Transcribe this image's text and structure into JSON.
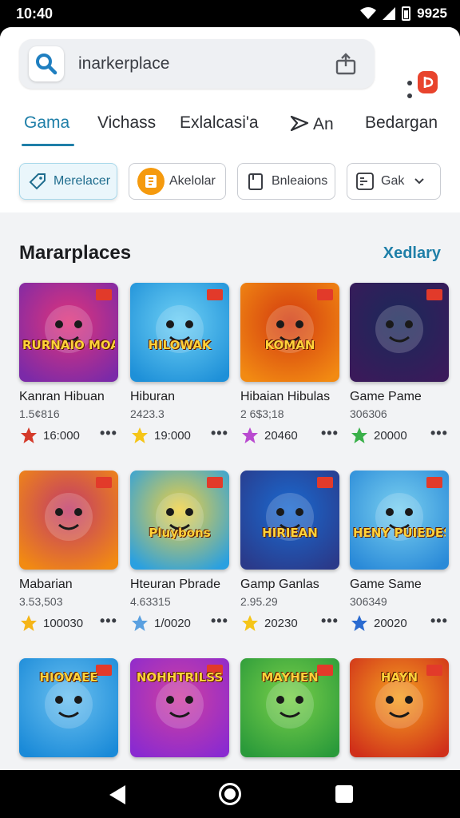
{
  "status": {
    "time": "10:40",
    "battery": "9925"
  },
  "search": {
    "query": "inarkerplace",
    "icon": "search-icon",
    "share_icon": "share-icon",
    "badge_icon": "app-badge-icon"
  },
  "tabs": [
    {
      "label": "Gama",
      "active": true
    },
    {
      "label": "Vichass",
      "active": false
    },
    {
      "label": "Exlalcasi'a",
      "active": false
    },
    {
      "label": "An",
      "active": false,
      "icon": "arrow-icon"
    },
    {
      "label": "Bedargan",
      "active": false
    }
  ],
  "chips": [
    {
      "label": "Merelacer",
      "icon": "tag-icon",
      "active": true
    },
    {
      "label": "Akelolar",
      "icon": "app-icon",
      "active": false
    },
    {
      "label": "Bnleaions",
      "icon": "copy-icon",
      "active": false
    },
    {
      "label": "Gak",
      "icon": "filter-icon",
      "active": false,
      "dropdown": true
    }
  ],
  "section": {
    "title": "Mararplaces",
    "link": "Xedlary"
  },
  "cards": [
    {
      "name": "Kanran Hibuan",
      "number": "1.5¢816",
      "meta": "16:000",
      "art": "RURNAIO MOAMENG",
      "colors": [
        "#7b2aa8",
        "#e0347a"
      ]
    },
    {
      "name": "Hiburan",
      "number": "2423.3",
      "meta": "19:000",
      "art": "HILOWAK",
      "colors": [
        "#1e90d8",
        "#6ed0f5"
      ]
    },
    {
      "name": "Hibaian Hibulas",
      "number": "2 6$3;18",
      "meta": "20460",
      "art": "KOMAN",
      "colors": [
        "#f28a12",
        "#d23a10"
      ]
    },
    {
      "name": "Game Pame",
      "number": "306306",
      "meta": "20000",
      "art": "",
      "colors": [
        "#3a1a5a",
        "#1a2a5a"
      ]
    },
    {
      "name": "Mabarian",
      "number": "3.53,503",
      "meta": "100030",
      "art": "",
      "colors": [
        "#f28a12",
        "#c03a6a"
      ]
    },
    {
      "name": "Hteuran Pbrade",
      "number": "4.63315",
      "meta": "1/0020",
      "art": "Pluybons",
      "colors": [
        "#2aa0e0",
        "#f0d040"
      ]
    },
    {
      "name": "Gamp Ganlas",
      "number": "2.95.29",
      "meta": "20230",
      "art": "HIRIEAN",
      "colors": [
        "#2a3a8a",
        "#1a6ad0"
      ]
    },
    {
      "name": "Game Same",
      "number": "306349",
      "meta": "20020",
      "art": "HENY PUIEDES",
      "colors": [
        "#2a8ad8",
        "#7ad0f0"
      ]
    },
    {
      "name": "",
      "number": "",
      "meta": "",
      "art": "HIOVAEE",
      "colors": [
        "#1a8ad8",
        "#6ac0f0"
      ]
    },
    {
      "name": "",
      "number": "",
      "meta": "",
      "art": "NOHHTRILSS",
      "colors": [
        "#8a2ad0",
        "#d040a0"
      ]
    },
    {
      "name": "",
      "number": "",
      "meta": "",
      "art": "MAYHEN",
      "colors": [
        "#2a9a3a",
        "#7ad04a"
      ]
    },
    {
      "name": "",
      "number": "",
      "meta": "",
      "art": "HAYN",
      "colors": [
        "#d0301a",
        "#f5a020"
      ]
    }
  ],
  "nav": {
    "back": "back-icon",
    "home": "home-icon",
    "recent": "recents-icon"
  }
}
